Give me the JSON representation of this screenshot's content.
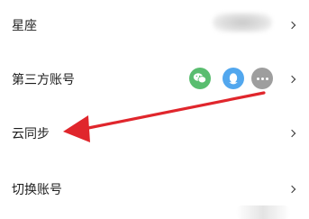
{
  "settings": {
    "items": [
      {
        "label": "星座"
      },
      {
        "label": "第三方账号"
      },
      {
        "label": "云同步"
      },
      {
        "label": "切换账号"
      }
    ]
  },
  "accounts": {
    "icons": [
      "wechat-icon",
      "qq-icon",
      "more-icon"
    ]
  },
  "colors": {
    "arrow": "#e0262c",
    "wechat": "#59bd6f",
    "qq": "#52a7ee",
    "more": "#9e9e9e"
  }
}
